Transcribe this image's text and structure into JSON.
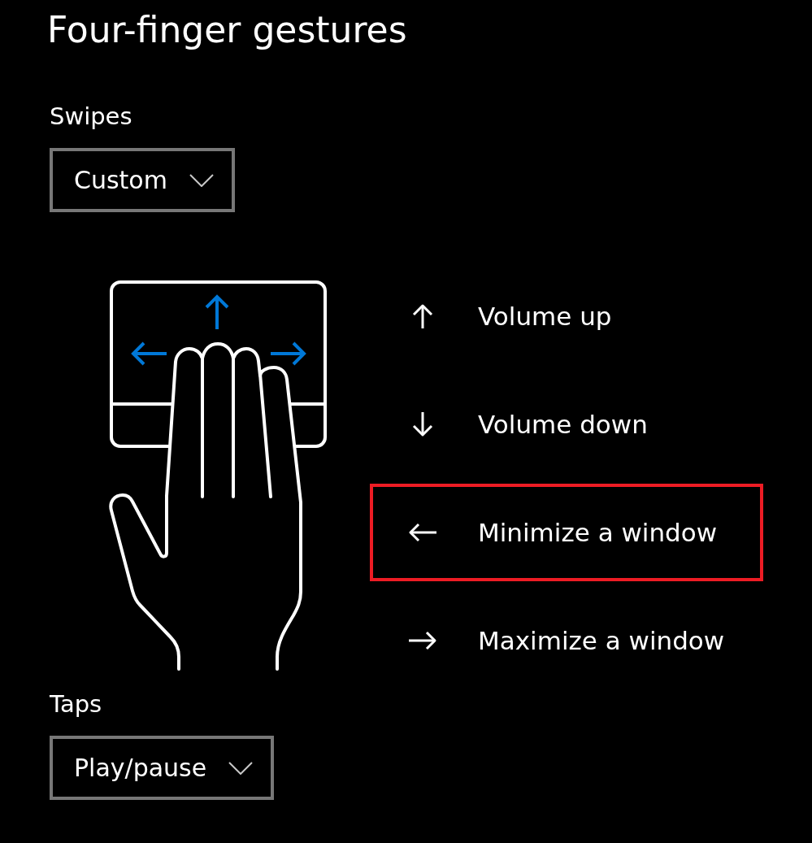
{
  "title": "Four-finger gestures",
  "swipes": {
    "label": "Swipes",
    "dropdown": {
      "value": "Custom"
    }
  },
  "gestures": [
    {
      "kind": "up",
      "action": "Volume up",
      "highlighted": false
    },
    {
      "kind": "down",
      "action": "Volume down",
      "highlighted": false
    },
    {
      "kind": "left",
      "action": "Minimize a window",
      "highlighted": true
    },
    {
      "kind": "right",
      "action": "Maximize a window",
      "highlighted": false
    }
  ],
  "taps": {
    "label": "Taps",
    "dropdown": {
      "value": "Play/pause"
    }
  }
}
